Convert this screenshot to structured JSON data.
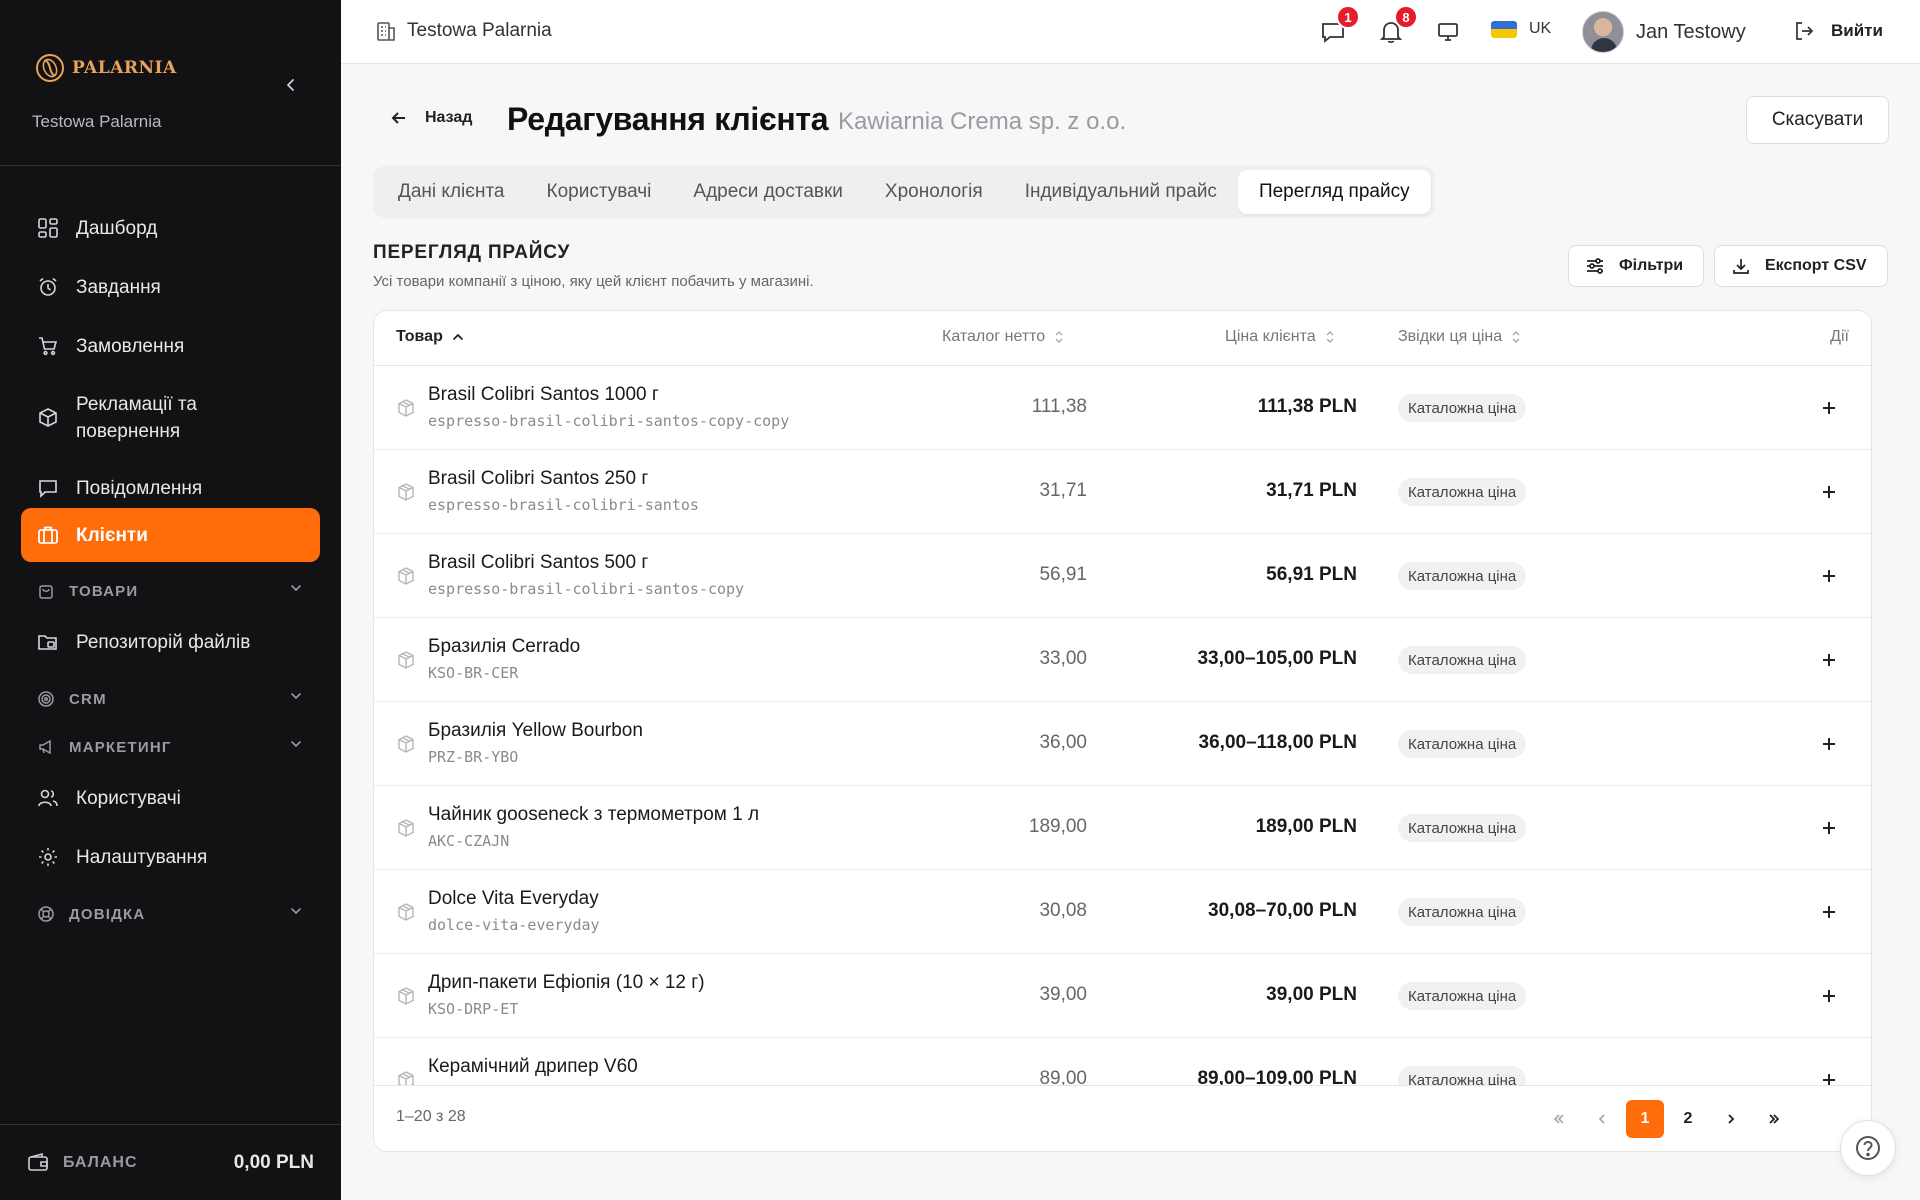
{
  "brand": {
    "name": "PALARNIA",
    "company": "Testowa Palarnia"
  },
  "sidebar": {
    "items": [
      {
        "label": "Дашборд"
      },
      {
        "label": "Завдання"
      },
      {
        "label": "Замовлення"
      },
      {
        "label": "Рекламації та повернення"
      },
      {
        "label": "Повідомлення"
      },
      {
        "label": "Клієнти"
      },
      {
        "label": "ТОВАРИ"
      },
      {
        "label": "Репозиторій файлів"
      },
      {
        "label": "CRM"
      },
      {
        "label": "МАРКЕТИНГ"
      },
      {
        "label": "Користувачі"
      },
      {
        "label": "Налаштування"
      },
      {
        "label": "ДОВІДКА"
      }
    ],
    "active_index": 5,
    "balance": {
      "label": "БАЛАНС",
      "value": "0,00 PLN"
    }
  },
  "topbar": {
    "company": "Testowa Palarnia",
    "messages_badge": "1",
    "notifications_badge": "8",
    "language": "UK",
    "user_name": "Jan Testowy",
    "logout_label": "Вийти"
  },
  "header": {
    "back_label": "Назад",
    "title": "Редагування клієнта",
    "subtitle": "Kawiarnia Crema sp. z o.o.",
    "cancel_label": "Скасувати"
  },
  "tabs": [
    {
      "label": "Дані клієнта"
    },
    {
      "label": "Користувачі"
    },
    {
      "label": "Адреси доставки"
    },
    {
      "label": "Хронологія"
    },
    {
      "label": "Індивідуальний прайс"
    },
    {
      "label": "Перегляд прайсу"
    }
  ],
  "active_tab": 5,
  "section": {
    "title": "ПЕРЕГЛЯД ПРАЙСУ",
    "description": "Усі товари компанії з ціною, яку цей клієнт побачить у магазині.",
    "filters_label": "Фільтри",
    "export_label": "Експорт CSV"
  },
  "table": {
    "columns": {
      "product": "Товар",
      "catalog_net": "Каталог нетто",
      "client_price": "Ціна клієнта",
      "source": "Звідки ця ціна",
      "actions": "Дії"
    },
    "rows": [
      {
        "name": "Brasil Colibri Santos 1000 г",
        "sku": "espresso-brasil-colibri-santos-copy-copy",
        "catalog": "111,38",
        "client": "111,38 PLN",
        "source": "Каталожна ціна"
      },
      {
        "name": "Brasil Colibri Santos 250 г",
        "sku": "espresso-brasil-colibri-santos",
        "catalog": "31,71",
        "client": "31,71 PLN",
        "source": "Каталожна ціна"
      },
      {
        "name": "Brasil Colibri Santos 500 г",
        "sku": "espresso-brasil-colibri-santos-copy",
        "catalog": "56,91",
        "client": "56,91 PLN",
        "source": "Каталожна ціна"
      },
      {
        "name": "Бразилія Cerrado",
        "sku": "KSO-BR-CER",
        "catalog": "33,00",
        "client": "33,00–105,00 PLN",
        "source": "Каталожна ціна"
      },
      {
        "name": "Бразилія Yellow Bourbon",
        "sku": "PRZ-BR-YBO",
        "catalog": "36,00",
        "client": "36,00–118,00 PLN",
        "source": "Каталожна ціна"
      },
      {
        "name": "Чайник gooseneck з термометром 1 л",
        "sku": "AKC-CZAJN",
        "catalog": "189,00",
        "client": "189,00 PLN",
        "source": "Каталожна ціна"
      },
      {
        "name": "Dolce Vita Everyday",
        "sku": "dolce-vita-everyday",
        "catalog": "30,08",
        "client": "30,08–70,00 PLN",
        "source": "Каталожна ціна"
      },
      {
        "name": "Дрип-пакети Ефіопія (10 × 12 г)",
        "sku": "KSO-DRP-ET",
        "catalog": "39,00",
        "client": "39,00 PLN",
        "source": "Каталожна ціна"
      },
      {
        "name": "Керамічний дрипер V60",
        "sku": "",
        "catalog": "89,00",
        "client": "89,00–109,00 PLN",
        "source": "Каталожна ціна"
      }
    ],
    "range_label": "1–20 з 28",
    "pages": [
      "1",
      "2"
    ],
    "current_page": "1"
  }
}
